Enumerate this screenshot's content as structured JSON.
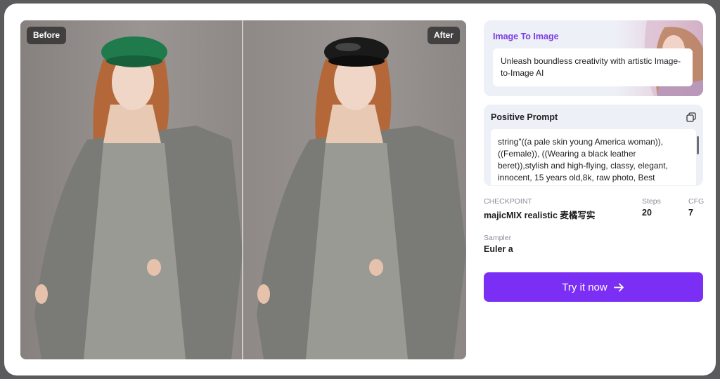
{
  "compare": {
    "before_label": "Before",
    "after_label": "After"
  },
  "hero": {
    "title": "Image To Image",
    "description": "Unleash boundless creativity with artistic Image-to-Image AI"
  },
  "prompt": {
    "title": "Positive Prompt",
    "text": "string\"((a pale skin young America woman)), ((Female)), ((Wearing a black leather beret)),stylish and high-flying, classy, elegant, innocent, 15 years old,8k, raw photo, Best"
  },
  "meta": {
    "checkpoint_label": "CHECKPOINT",
    "checkpoint_value": "majicMIX realistic 麦橘写实",
    "steps_label": "Steps",
    "steps_value": "20",
    "cfg_label": "CFG",
    "cfg_value": "7",
    "sampler_label": "Sampler",
    "sampler_value": "Euler a"
  },
  "cta": {
    "label": "Try it now"
  },
  "colors": {
    "accent": "#7b2ff5",
    "hat_before": "#1f7a4c",
    "hat_after": "#1a1a1a",
    "dress": "#8c8c88"
  }
}
